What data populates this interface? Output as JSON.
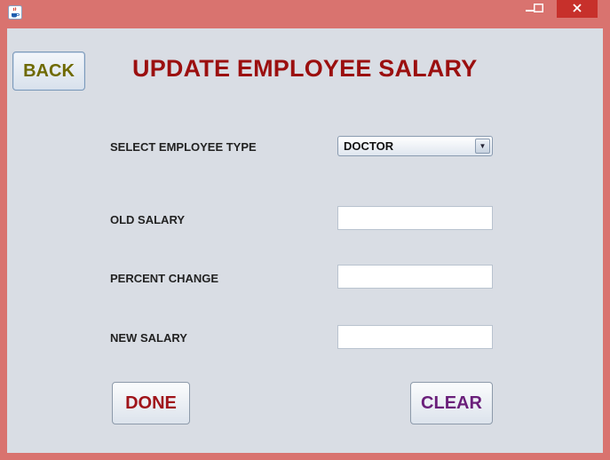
{
  "window": {
    "title": "",
    "controls": {
      "minimize": "–",
      "maximize": "□",
      "close": "✕"
    },
    "frame_color": "#d9736f",
    "close_color": "#c7302b"
  },
  "header": {
    "back_label": "BACK",
    "title": "UPDATE EMPLOYEE SALARY",
    "title_color": "#9b0f0f"
  },
  "form": {
    "employee_type": {
      "label": "SELECT EMPLOYEE TYPE",
      "selected": "DOCTOR"
    },
    "old_salary": {
      "label": "OLD SALARY",
      "value": ""
    },
    "percent_change": {
      "label": "PERCENT CHANGE",
      "value": ""
    },
    "new_salary": {
      "label": "NEW SALARY",
      "value": ""
    }
  },
  "actions": {
    "done_label": "DONE",
    "clear_label": "CLEAR"
  },
  "icons": {
    "app": "java-cup-icon",
    "dropdown": "dropdown-arrow-icon"
  }
}
